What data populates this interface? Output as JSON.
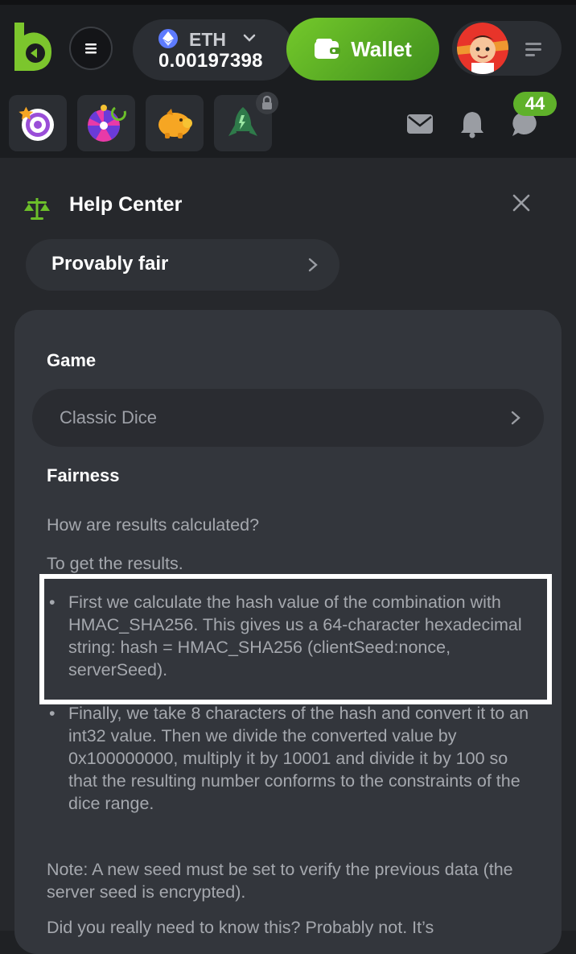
{
  "header": {
    "currency": "ETH",
    "balance": "0.00197398",
    "wallet_label": "Wallet"
  },
  "subbar": {
    "chat_badge": "44"
  },
  "help": {
    "title": "Help Center",
    "section": "Provably fair"
  },
  "content": {
    "game_label": "Game",
    "game_value": "Classic Dice",
    "fairness_label": "Fairness",
    "question": "How are results calculated?",
    "intro": "To get the results.",
    "steps": [
      "First we calculate the hash value of the combination with HMAC_SHA256. This gives us a 64-character hexadecimal string: hash = HMAC_SHA256 (clientSeed:nonce, serverSeed).",
      "Finally, we take 8 characters of the hash and convert it to an int32 value. Then we divide the converted value by 0x100000000, multiply it by 10001 and divide it by 100 so that the resulting number conforms to the constraints of the dice range."
    ],
    "note": "Note: A new seed must be set to verify the previous data (the server seed is encrypted).",
    "outro": "Did you really need to know this? Probably not. It’s"
  },
  "colors": {
    "accent": "#6cbf2a",
    "background": "#26282c",
    "card": "#33363c",
    "highlight_border": "#ffffff"
  },
  "icons": [
    "logo-icon",
    "menu-icon",
    "eth-icon",
    "chevron-down-icon",
    "wallet-icon",
    "avatar",
    "list-icon",
    "spin-icon",
    "wheel-icon",
    "piggy-bank-icon",
    "rocket-icon",
    "lock-icon",
    "mail-icon",
    "bell-icon",
    "chat-icon",
    "scales-icon",
    "close-icon",
    "chevron-right-icon"
  ]
}
